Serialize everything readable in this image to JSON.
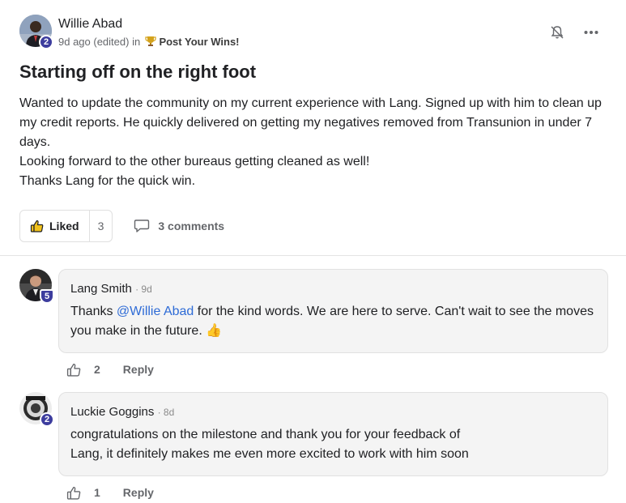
{
  "post": {
    "author": "Willie Abad",
    "author_level": "2",
    "meta_time": "9d ago (edited) in",
    "category_icon": "trophy-icon",
    "category": "Post Your Wins!",
    "title": "Starting off on the right foot",
    "body": [
      "Wanted to update the community on my current experience with Lang. Signed up with him to clean up my credit reports. He quickly delivered on getting my negatives removed from Transunion in under 7 days.",
      "Looking forward to the other bureaus getting cleaned as well!",
      "Thanks Lang for the quick win."
    ],
    "like_label": "Liked",
    "like_count": "3",
    "comments_label": "3 comments"
  },
  "comments": [
    {
      "author": "Lang Smith",
      "level": "5",
      "time": "· 9d",
      "text_before": "Thanks ",
      "mention": "@Willie Abad",
      "text_after": " for the kind words. We are here to serve. Can't wait to see the moves you make in the future. ",
      "emoji": "👍",
      "likes": "2",
      "reply_label": "Reply"
    },
    {
      "author": "Luckie Goggins",
      "level": "2",
      "time": "· 8d",
      "text_line1": "congratulations on the milestone and thank you for your feedback of",
      "text_line2": "Lang, it definitely makes me even more excited to work with him soon",
      "likes": "1",
      "reply_label": "Reply"
    }
  ],
  "colors": {
    "accent": "#3d3d9e",
    "mention": "#2e6bd6",
    "bubble": "#f4f4f4"
  }
}
